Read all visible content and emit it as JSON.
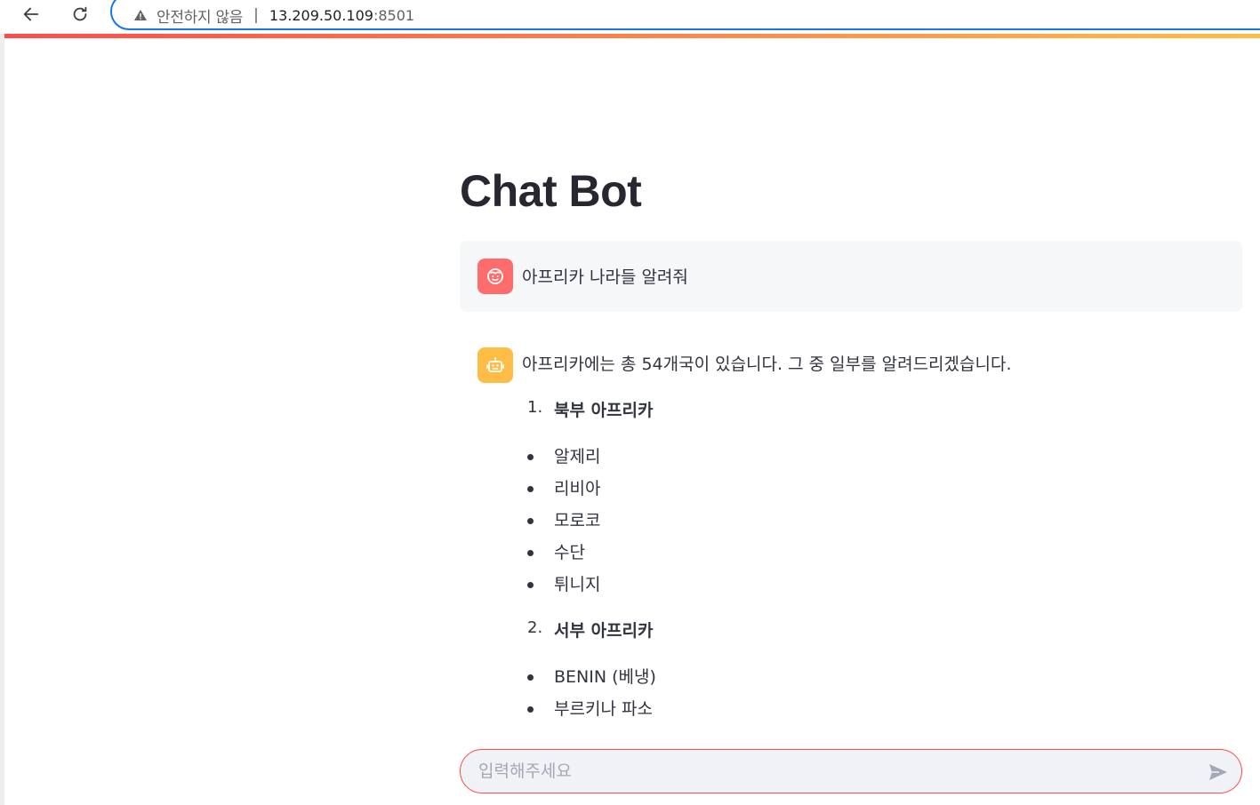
{
  "browser": {
    "insecure_label": "안전하지 않음",
    "separator": "|",
    "url_host": "13.209.50.109",
    "url_port": ":8501"
  },
  "app": {
    "title": "Chat Bot"
  },
  "messages": {
    "user": {
      "text": "아프리카 나라들 알려줘",
      "avatar_icon": "face-icon",
      "avatar_color": "#ff6c6c"
    },
    "assistant": {
      "intro": "아프리카에는 총 54개국이 있습니다. 그 중 일부를 알려드리겠습니다.",
      "avatar_icon": "robot-icon",
      "avatar_color": "#ffbd45",
      "sections": [
        {
          "number": "1.",
          "title": "북부 아프리카",
          "items": [
            "알제리",
            "리비아",
            "모로코",
            "수단",
            "튀니지"
          ]
        },
        {
          "number": "2.",
          "title": "서부 아프리카",
          "items": [
            "BENIN (베냉)",
            "부르키나 파소"
          ]
        }
      ]
    }
  },
  "chat_input": {
    "placeholder": "입력해주세요",
    "value": "",
    "send_icon": "send-icon"
  },
  "colors": {
    "accent": "#ff4b4b",
    "user_bubble_bg": "#f6f7f9",
    "input_bg": "#f0f2f6"
  }
}
